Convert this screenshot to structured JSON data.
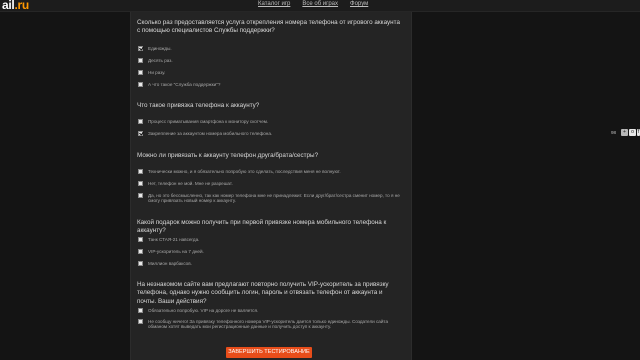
{
  "header": {
    "logo_text": "ail",
    "logo_suffix": ".ru",
    "nav": [
      "Каталог игр",
      "Все об играх",
      "Форум"
    ]
  },
  "questions": [
    {
      "text": "Сколько раз предоставляется услуга открепления номера телефона от игрового аккаунта с помощью специалистов Службы поддержки?",
      "options": [
        {
          "label": "Единожды.",
          "checked": true
        },
        {
          "label": "Десять раз.",
          "checked": false
        },
        {
          "label": "Ни разу.",
          "checked": false
        },
        {
          "label": "А что такое \"Служба поддержки\"?",
          "checked": false
        }
      ]
    },
    {
      "text": "Что такое привязка телефона к аккаунту?",
      "options": [
        {
          "label": "Процесс приматывания смартфона к монитору скотчем.",
          "checked": false
        },
        {
          "label": "Закрепление за аккаунтом номера мобильного телефона.",
          "checked": true
        }
      ]
    },
    {
      "text": "Можно ли привязать к аккаунту телефон друга/брата/сестры?",
      "options": [
        {
          "label": "Технически можно, и я обязательно попробую это сделать, последствия меня не волнуют.",
          "checked": false
        },
        {
          "label": "Нет, телефон не мой. Мне не разрешат.",
          "checked": false
        },
        {
          "label": "Да, но это бессмысленно, так как номер телефона мне не принадлежит. Если друг/брат/сестра сменит номер, то я не смогу привязать новый номер к аккаунту.",
          "checked": false
        }
      ]
    },
    {
      "text": "Какой подарок можно получить при первой привязке номера мобильного телефона к аккаунту?",
      "options": [
        {
          "label": "Танк СТАЯ-21 навсегда.",
          "checked": false
        },
        {
          "label": "VIP-ускоритель на 7 дней.",
          "checked": false
        },
        {
          "label": "Миллион варбаксов.",
          "checked": false
        }
      ]
    },
    {
      "text": "На незнакомом сайте вам предлагают повторно получить VIP-ускоритель за привязку телефона, однако нужно сообщить логин, пароль и отвязать телефон от аккаунта и почты. Ваши действия?",
      "options": [
        {
          "label": "Обязательно попробую. VIP на дороге не валяется.",
          "checked": false
        },
        {
          "label": "Не сообщу ничего! За привязку телефонного номера VIP-ускоритель дается только единожды. Создатели сайта обманом хотят выведать мои регистрационные данные и получить доступ к аккаунту.",
          "checked": false
        }
      ]
    }
  ],
  "finish_button": "Завершить тестирование",
  "side": {
    "count": "98",
    "icons": [
      "like-icon",
      "odnoklassniki-icon",
      "facebook-icon"
    ],
    "icon_glyphs": [
      "+",
      "o",
      "f"
    ],
    "icon_colors": [
      "#b8b8b8",
      "#e8e8e8",
      "#e8e8e8"
    ]
  }
}
